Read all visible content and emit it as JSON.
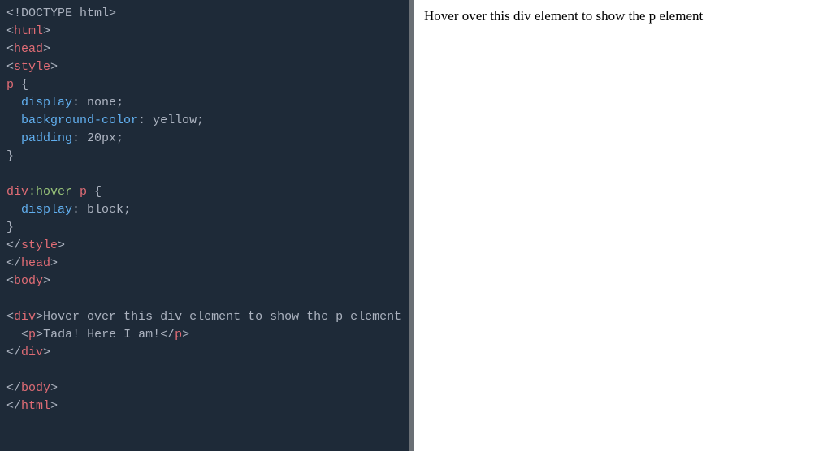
{
  "code": {
    "l1_doctype": "<!DOCTYPE html>",
    "l2_open": "<",
    "l2_tag": "html",
    "l2_close": ">",
    "l3_open": "<",
    "l3_tag": "head",
    "l3_close": ">",
    "l4_open": "<",
    "l4_tag": "style",
    "l4_close": ">",
    "l5_sel": "p",
    "l5_brace": " {",
    "l6_prop": "  display",
    "l6_colon": ": ",
    "l6_val": "none",
    "l6_semi": ";",
    "l7_prop": "  background-color",
    "l7_colon": ": ",
    "l7_val": "yellow",
    "l7_semi": ";",
    "l8_prop": "  padding",
    "l8_colon": ": ",
    "l8_val": "20px",
    "l8_semi": ";",
    "l9_brace": "}",
    "l10_blank": "",
    "l11_sel1": "div",
    "l11_pseudo": ":hover",
    "l11_sel2": " p",
    "l11_brace": " {",
    "l12_prop": "  display",
    "l12_colon": ": ",
    "l12_val": "block",
    "l12_semi": ";",
    "l13_brace": "}",
    "l14_open": "</",
    "l14_tag": "style",
    "l14_close": ">",
    "l15_open": "</",
    "l15_tag": "head",
    "l15_close": ">",
    "l16_open": "<",
    "l16_tag": "body",
    "l16_close": ">",
    "l17_blank": "",
    "l18_open": "<",
    "l18_tag": "div",
    "l18_close": ">",
    "l18_text": "Hover over this div element to show the p element",
    "l19_open": "  <",
    "l19_tag": "p",
    "l19_close": ">",
    "l19_text": "Tada! Here I am!",
    "l19_open2": "</",
    "l19_tag2": "p",
    "l19_close2": ">",
    "l20_open": "</",
    "l20_tag": "div",
    "l20_close": ">",
    "l21_blank": "",
    "l22_open": "</",
    "l22_tag": "body",
    "l22_close": ">",
    "l23_open": "</",
    "l23_tag": "html",
    "l23_close": ">"
  },
  "output": {
    "visible_text": "Hover over this div element to show the p element"
  }
}
